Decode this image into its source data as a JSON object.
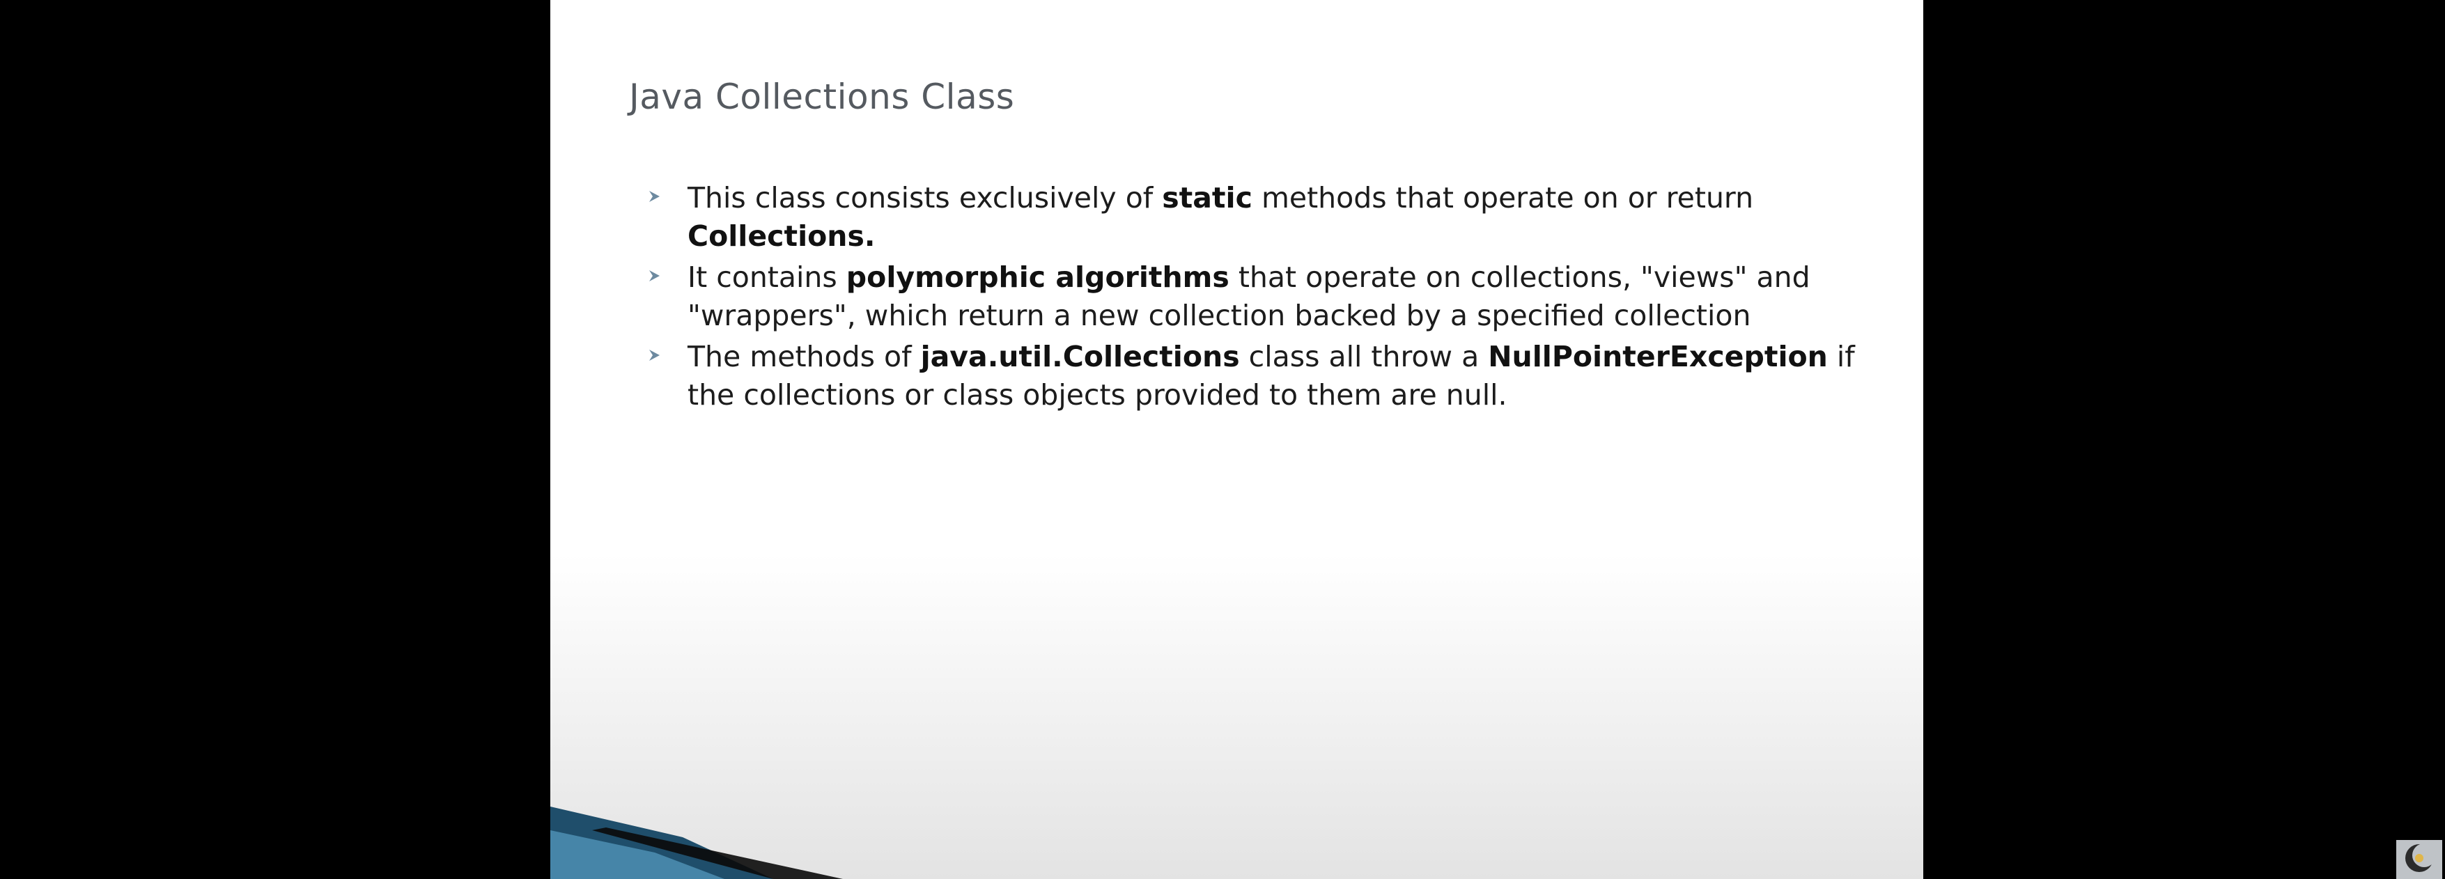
{
  "slide": {
    "title": "Java Collections Class",
    "bullets": [
      {
        "parts": [
          {
            "text": "This class consists exclusively of ",
            "bold": false
          },
          {
            "text": "static",
            "bold": true
          },
          {
            "text": " methods that operate on or return ",
            "bold": false
          },
          {
            "text": "Collections.",
            "bold": true
          }
        ]
      },
      {
        "parts": [
          {
            "text": "It contains ",
            "bold": false
          },
          {
            "text": "polymorphic algorithms",
            "bold": true
          },
          {
            "text": " that operate on collections, \"views\" and \"wrappers\", which return a new collection backed by a specified collection",
            "bold": false
          }
        ]
      },
      {
        "parts": [
          {
            "text": "The methods of ",
            "bold": false
          },
          {
            "text": "java.util.Collections",
            "bold": true
          },
          {
            "text": " class all throw a ",
            "bold": false
          },
          {
            "text": "NullPointerException",
            "bold": true
          },
          {
            "text": " if the collections or class objects provided to them are null.",
            "bold": false
          }
        ]
      }
    ]
  },
  "colors": {
    "background": "#000000",
    "slide": "#ffffff",
    "title": "#555a60",
    "bullet_marker": "#6d8aa0",
    "accent_dark": "#1f4e6b",
    "accent_light": "#4d8fb3"
  },
  "icons": {
    "bullet": "arrowhead-icon",
    "corner_logo": "crescent-logo-icon"
  }
}
